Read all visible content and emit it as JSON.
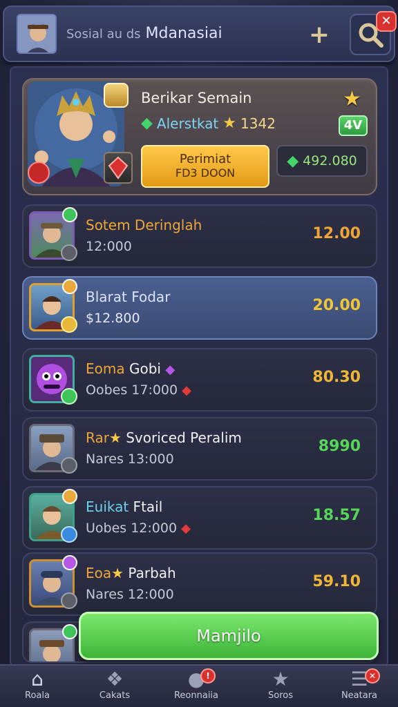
{
  "header": {
    "title_muted": "Sosial au ds",
    "title": "Mdanasiai",
    "add_icon": "plus-icon",
    "search_icon": "search-icon",
    "close_icon": "close-icon"
  },
  "profile": {
    "name": "Berikar Semain",
    "level_label": "Alerstkat",
    "level_value": "1342",
    "level_badge": "4V",
    "promo_line1": "Perimiat",
    "promo_line2": "FD3 DOON",
    "gems": "492.080"
  },
  "rows": [
    {
      "title_a": "Sotem Deringlah",
      "title_b": "",
      "sub": "12:000",
      "price": "12.00",
      "price_color": "#f0a637",
      "selected": false
    },
    {
      "title_a": "Blarat Fodar",
      "title_b": "",
      "sub": "$12.800",
      "price": "20.00",
      "price_color": "#f0c637",
      "selected": true
    },
    {
      "title_a": "Eoma",
      "title_b": " Gobi",
      "sub": "Oobes 17:000",
      "price": "80.30",
      "price_color": "#f0b637",
      "selected": false
    },
    {
      "title_a": "Rar",
      "title_b": " Svoriced Peralim",
      "sub": "Nares 13:000",
      "price": "8990",
      "price_color": "#58d65a",
      "selected": false
    },
    {
      "title_a": "Euikat",
      "title_b": " Ftail",
      "sub": "Uobes 12:000",
      "price": "18.57",
      "price_color": "#58d65a",
      "selected": false
    },
    {
      "title_a": "Eoa",
      "title_b": " Parbah",
      "sub": "Nares 12:000",
      "price": "59.10",
      "price_color": "#f0b637",
      "selected": false
    }
  ],
  "confirm_button": "Mamjilo",
  "nav": [
    {
      "label": "Roala",
      "icon": "home-icon"
    },
    {
      "label": "Cakats",
      "icon": "cards-icon"
    },
    {
      "label": "Reonnaiia",
      "icon": "chat-icon"
    },
    {
      "label": "Soros",
      "icon": "star-icon"
    },
    {
      "label": "Neatara",
      "icon": "menu-icon"
    }
  ],
  "colors": {
    "accent_gold": "#f7c948",
    "accent_green": "#3db53a",
    "alert_red": "#d8312f"
  }
}
